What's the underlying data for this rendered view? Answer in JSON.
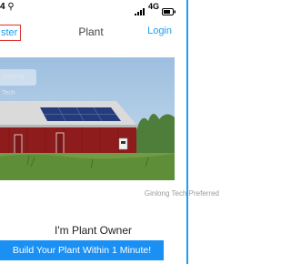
{
  "status_bar": {
    "time": "4 ⚲",
    "network": "4G",
    "signal_icon": "signal-bars",
    "battery_icon": "battery"
  },
  "nav": {
    "register_label": "ster",
    "title": "Plant",
    "login_label": "Login"
  },
  "photo": {
    "watermark": "Ginlong Tech"
  },
  "tagline": "Ginlong Tech Preferred",
  "owner_title": "I'm Plant Owner",
  "build_button_label": "Build Your Plant Within 1 Minute!",
  "colors": {
    "accent": "#1a9ff0",
    "button": "#1a8ff4",
    "register_border": "#e03030",
    "barn_red": "#8e1c1c"
  }
}
